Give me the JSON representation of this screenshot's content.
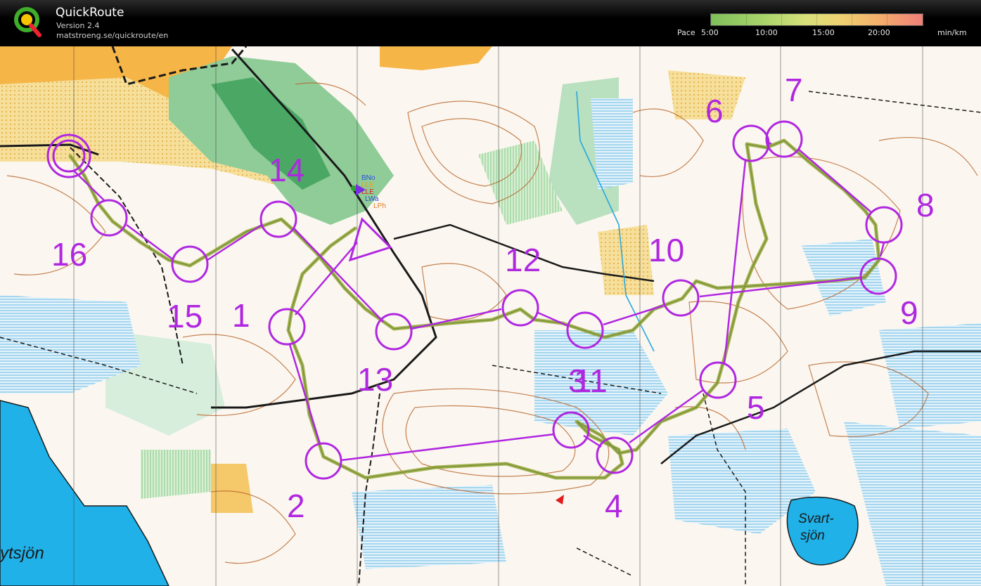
{
  "app": {
    "title": "QuickRoute",
    "version": "Version 2.4",
    "url": "matstroeng.se/quickroute/en"
  },
  "pace_legend": {
    "label": "Pace",
    "ticks": [
      "5:00",
      "10:00",
      "15:00",
      "20:00"
    ],
    "unit": "min/km",
    "colors": [
      "#7fbf5a",
      "#d8e07a",
      "#f0d070",
      "#ef7f78"
    ]
  },
  "map": {
    "course_color": "#b027e0",
    "route_color": "#9aa83c",
    "control_labels": [
      "1",
      "2",
      "3",
      "4",
      "5",
      "6",
      "7",
      "8",
      "9",
      "10",
      "11",
      "12",
      "13",
      "14",
      "15",
      "16"
    ],
    "lake_labels": [
      "Svart-",
      "sjön",
      "ytsjön"
    ],
    "start_markers": [
      "BNo",
      "LLE",
      "LLE",
      "LWa",
      "LPh"
    ]
  }
}
